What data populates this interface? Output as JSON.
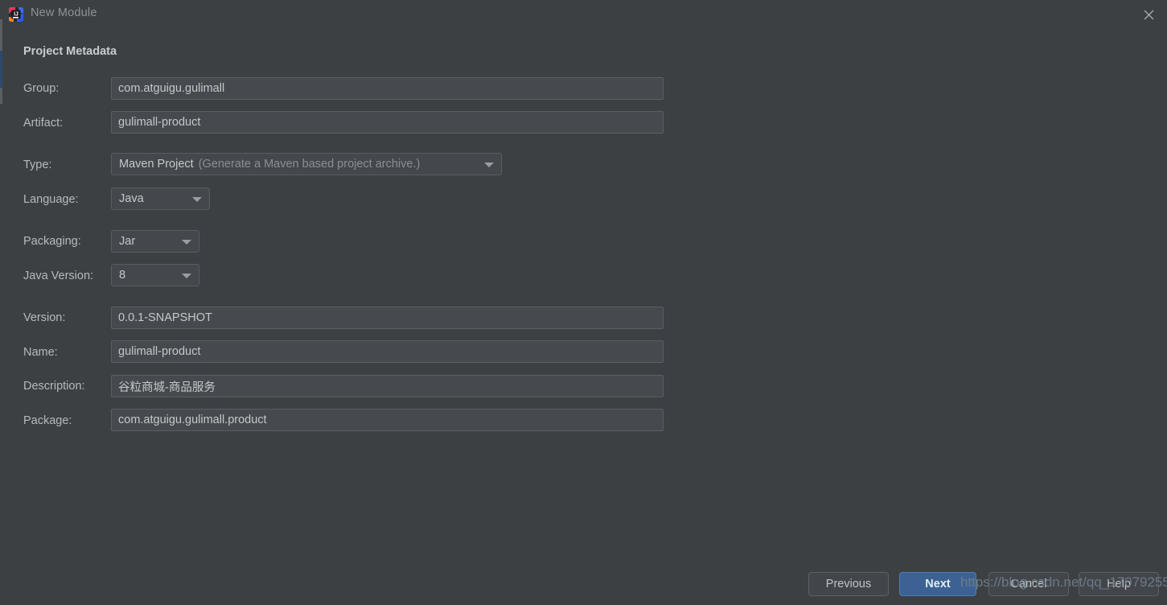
{
  "window": {
    "title": "New Module",
    "logo_icon": "intellij-idea-logo-icon",
    "close_icon": "close-icon"
  },
  "section": {
    "title": "Project Metadata"
  },
  "fields": [
    {
      "label": "Group:",
      "value": "com.atguigu.gulimall",
      "kind": "text"
    },
    {
      "label": "Artifact:",
      "value": "gulimall-product",
      "kind": "text"
    },
    {
      "label": "Type:",
      "value": "Maven Project",
      "hint": "(Generate a Maven based project archive.)",
      "kind": "combo"
    },
    {
      "label": "Language:",
      "value": "Java",
      "kind": "combo"
    },
    {
      "label": "Packaging:",
      "value": "Jar",
      "kind": "combo"
    },
    {
      "label": "Java Version:",
      "value": "8",
      "kind": "combo"
    },
    {
      "label": "Version:",
      "value": "0.0.1-SNAPSHOT",
      "kind": "text"
    },
    {
      "label": "Name:",
      "value": "gulimall-product",
      "kind": "text"
    },
    {
      "label": "Description:",
      "value": "谷粒商城-商品服务",
      "kind": "text"
    },
    {
      "label": "Package:",
      "value": "com.atguigu.gulimall.product",
      "kind": "text"
    }
  ],
  "buttons": {
    "previous": "Previous",
    "next": "Next",
    "cancel": "Cancel",
    "help": "Help"
  },
  "watermark": "https://blog.csdn.net/qq_17079255",
  "colors": {
    "background": "#3c4043",
    "input_fill": "#46494d",
    "primary_button": "#3c6293",
    "accent_strip": "#2c4a6e"
  }
}
